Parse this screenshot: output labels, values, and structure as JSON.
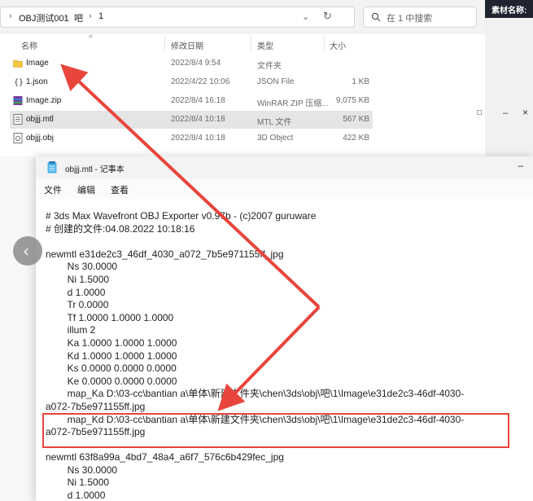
{
  "explorer": {
    "breadcrumb": [
      "OBJ测试001",
      "吧",
      "1"
    ],
    "search_placeholder": "在 1 中搜索",
    "columns": {
      "name": "名称",
      "modified": "修改日期",
      "type": "类型",
      "size": "大小"
    },
    "files": [
      {
        "name": "Image",
        "date": "2022/8/4 9:54",
        "type": "文件夹",
        "size": "",
        "icon": "folder-icon",
        "selected": false
      },
      {
        "name": "1.json",
        "date": "2022/4/22 10:06",
        "type": "JSON File",
        "size": "1 KB",
        "icon": "json-file-icon",
        "selected": false
      },
      {
        "name": "Image.zip",
        "date": "2022/8/4 16:18",
        "type": "WinRAR ZIP 压缩...",
        "size": "9,075 KB",
        "icon": "zip-archive-icon",
        "selected": false
      },
      {
        "name": "objjj.mtl",
        "date": "2022/8/4 10:18",
        "type": "MTL 文件",
        "size": "567 KB",
        "icon": "text-file-icon",
        "selected": true
      },
      {
        "name": "objjj.obj",
        "date": "2022/8/4 10:18",
        "type": "3D Object",
        "size": "422 KB",
        "icon": "3d-object-icon",
        "selected": false
      }
    ]
  },
  "right_panel": {
    "label": "素材名称:"
  },
  "notepad": {
    "title": "objjj.mtl - 记事本",
    "menu": [
      "文件",
      "编辑",
      "查看"
    ],
    "lines": [
      "# 3ds Max Wavefront OBJ Exporter v0.97b - (c)2007 guruware",
      "# 创建的文件:04.08.2022 10:18:16",
      "",
      "newmtl e31de2c3_46df_4030_a072_7b5e971155ff_jpg",
      "        Ns 30.0000",
      "        Ni 1.5000",
      "        d 1.0000",
      "        Tr 0.0000",
      "        Tf 1.0000 1.0000 1.0000",
      "        illum 2",
      "        Ka 1.0000 1.0000 1.0000",
      "        Kd 1.0000 1.0000 1.0000",
      "        Ks 0.0000 0.0000 0.0000",
      "        Ke 0.0000 0.0000 0.0000",
      "        map_Ka D:\\03-cc\\bantian a\\单体\\新建文件夹\\chen\\3ds\\obj\\吧\\1\\Image\\e31de2c3-46df-4030-",
      "a072-7b5e971155ff.jpg",
      "        map_Kd D:\\03-cc\\bantian a\\单体\\新建文件夹\\chen\\3ds\\obj\\吧\\1\\Image\\e31de2c3-46df-4030-",
      "a072-7b5e971155ff.jpg",
      "",
      "newmtl 63f8a99a_4bd7_48a4_a6f7_576c6b429fec_jpg",
      "        Ns 30.0000",
      "        Ni 1.5000",
      "        d 1.0000"
    ]
  },
  "colors": {
    "annotation": "#e8453c",
    "selection": "#e5e5e5",
    "folder": "#f4c542"
  }
}
